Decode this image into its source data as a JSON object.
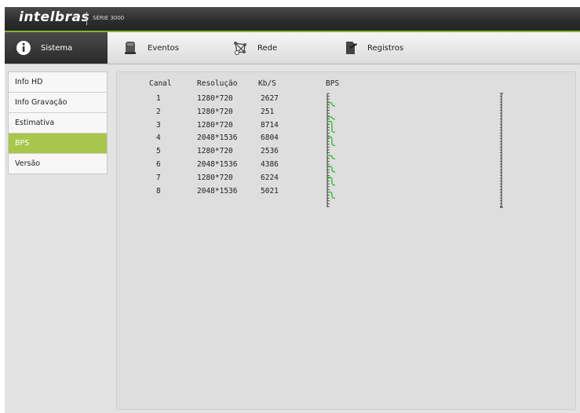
{
  "header": {
    "logo_text": "intelbras",
    "series_text": "SÉRIE 3000"
  },
  "nav": {
    "tabs": [
      {
        "label": "Sistema",
        "icon": "info-icon",
        "active": true
      },
      {
        "label": "Eventos",
        "icon": "camera-icon",
        "active": false
      },
      {
        "label": "Rede",
        "icon": "network-icon",
        "active": false
      },
      {
        "label": "Registros",
        "icon": "log-icon",
        "active": false
      }
    ]
  },
  "sidebar": {
    "items": [
      {
        "label": "Info HD",
        "active": false
      },
      {
        "label": "Info Gravação",
        "active": false
      },
      {
        "label": "Estimativa",
        "active": false
      },
      {
        "label": "BPS",
        "active": true
      },
      {
        "label": "Versão",
        "active": false
      }
    ]
  },
  "table": {
    "headers": [
      "Canal",
      "Resolução",
      "Kb/S",
      "BPS"
    ],
    "rows": [
      {
        "canal": "1",
        "resolucao": "1280*720",
        "kbs": "2627"
      },
      {
        "canal": "2",
        "resolucao": "1280*720",
        "kbs": "251"
      },
      {
        "canal": "3",
        "resolucao": "1280*720",
        "kbs": "8714"
      },
      {
        "canal": "4",
        "resolucao": "2048*1536",
        "kbs": "6804"
      },
      {
        "canal": "5",
        "resolucao": "1280*720",
        "kbs": "2536"
      },
      {
        "canal": "6",
        "resolucao": "2048*1536",
        "kbs": "4386"
      },
      {
        "canal": "7",
        "resolucao": "1280*720",
        "kbs": "6224"
      },
      {
        "canal": "8",
        "resolucao": "2048*1536",
        "kbs": "5021"
      }
    ]
  },
  "colors": {
    "accent_green": "#7fb43a",
    "sidebar_active": "#a7c64b",
    "graph_line": "#2ec02e"
  }
}
